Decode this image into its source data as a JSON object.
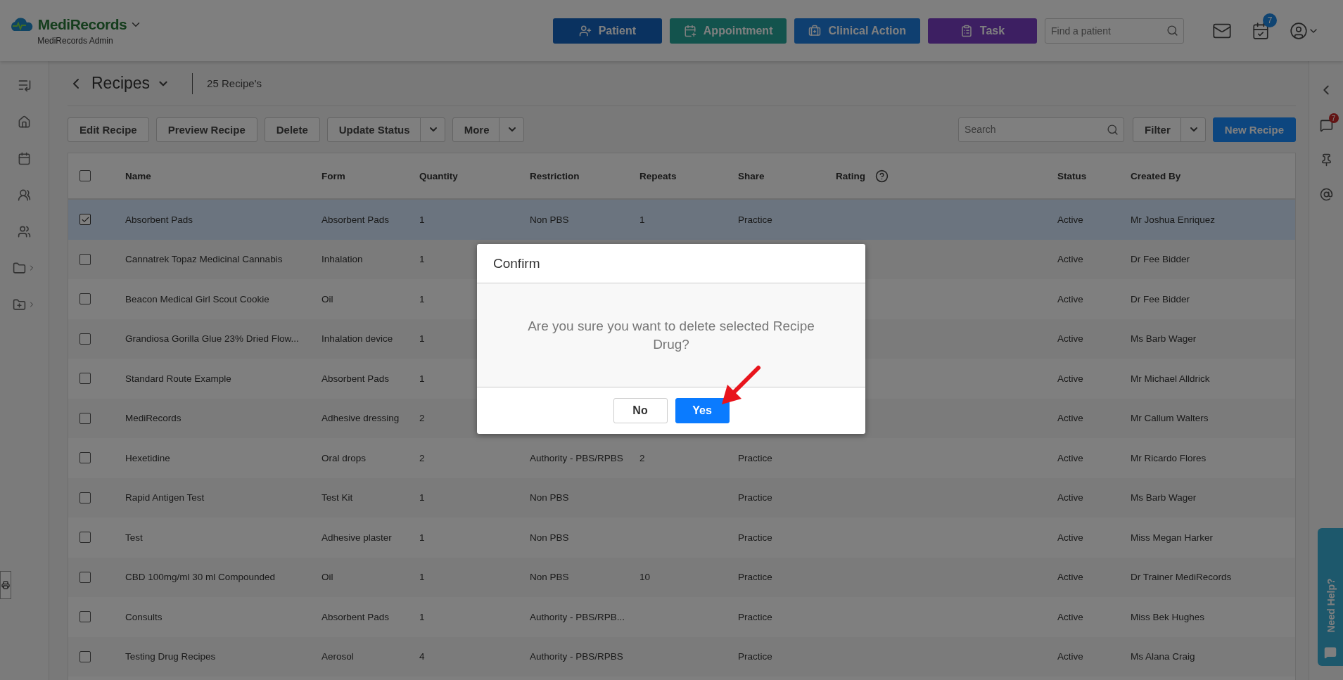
{
  "header": {
    "logo": "MediRecords",
    "subtitle": "MediRecords Admin",
    "actions": [
      {
        "label": "Patient"
      },
      {
        "label": "Appointment"
      },
      {
        "label": "Clinical Action"
      },
      {
        "label": "Task"
      }
    ],
    "search": {
      "placeholder": "Find a patient"
    },
    "calendar_badge": "7"
  },
  "page": {
    "title": "Recipes",
    "count": "25 Recipe's"
  },
  "toolbar": {
    "buttons": [
      {
        "label": "Edit Recipe",
        "kind": "plain"
      },
      {
        "label": "Preview Recipe",
        "kind": "plain"
      },
      {
        "label": "Delete",
        "kind": "plain"
      },
      {
        "label": "Update Status",
        "kind": "split"
      },
      {
        "label": "More",
        "kind": "split"
      }
    ],
    "search": {
      "placeholder": "Search"
    },
    "filter": {
      "label": "Filter",
      "kind": "split"
    },
    "primary": {
      "label": "New Recipe",
      "kind": "primary"
    }
  },
  "table": {
    "all_checked": false,
    "columns": [
      {
        "label": "Name",
        "help": false
      },
      {
        "label": "Form",
        "help": false
      },
      {
        "label": "Quantity",
        "help": false
      },
      {
        "label": "Restriction",
        "help": false
      },
      {
        "label": "Repeats",
        "help": false
      },
      {
        "label": "Share",
        "help": false
      },
      {
        "label": "Rating",
        "help": true
      },
      {
        "label": "Status",
        "help": false
      },
      {
        "label": "Created By",
        "help": false
      }
    ],
    "rows": [
      {
        "checked": true,
        "selected": true,
        "cells": [
          "Absorbent Pads",
          "Absorbent Pads",
          "1",
          "Non PBS",
          "1",
          "Practice",
          "",
          "Active",
          "Mr Joshua Enriquez"
        ]
      },
      {
        "checked": false,
        "selected": false,
        "cells": [
          "Cannatrek Topaz Medicinal Cannabis",
          "Inhalation",
          "1",
          "",
          "",
          "",
          "",
          "Active",
          "Dr Fee Bidder"
        ]
      },
      {
        "checked": false,
        "selected": false,
        "cells": [
          "Beacon Medical Girl Scout Cookie",
          "Oil",
          "1",
          "",
          "",
          "",
          "",
          "Active",
          "Dr Fee Bidder"
        ]
      },
      {
        "checked": false,
        "selected": false,
        "cells": [
          "Grandiosa Gorilla Glue 23% Dried Flow...",
          "Inhalation device",
          "1",
          "",
          "",
          "",
          "",
          "Active",
          "Ms Barb Wager"
        ]
      },
      {
        "checked": false,
        "selected": false,
        "cells": [
          "Standard Route Example",
          "Absorbent Pads",
          "1",
          "",
          "",
          "",
          "",
          "Active",
          "Mr Michael Alldrick"
        ]
      },
      {
        "checked": false,
        "selected": false,
        "cells": [
          "MediRecords",
          "Adhesive dressing",
          "2",
          "",
          "",
          "",
          "",
          "Active",
          "Mr Callum Walters"
        ]
      },
      {
        "checked": false,
        "selected": false,
        "cells": [
          "Hexetidine",
          "Oral drops",
          "2",
          "Authority - PBS/RPBS",
          "2",
          "Practice",
          "",
          "Active",
          "Mr Ricardo Flores"
        ]
      },
      {
        "checked": false,
        "selected": false,
        "cells": [
          "Rapid Antigen Test",
          "Test Kit",
          "1",
          "Non PBS",
          "",
          "Practice",
          "",
          "Active",
          "Ms Barb Wager"
        ]
      },
      {
        "checked": false,
        "selected": false,
        "cells": [
          "Test",
          "Adhesive plaster",
          "1",
          "Non PBS",
          "",
          "Practice",
          "",
          "Active",
          "Miss Megan Harker"
        ]
      },
      {
        "checked": false,
        "selected": false,
        "cells": [
          "CBD 100mg/ml 30 ml Compounded",
          "Oil",
          "1",
          "Non PBS",
          "10",
          "Practice",
          "",
          "Active",
          "Dr Trainer MediRecords"
        ]
      },
      {
        "checked": false,
        "selected": false,
        "cells": [
          "Consults",
          "Absorbent Pads",
          "1",
          "Authority - PBS/RPB...",
          "",
          "Practice",
          "",
          "Active",
          "Miss Bek Hughes"
        ]
      },
      {
        "checked": false,
        "selected": false,
        "cells": [
          "Testing Drug Recipes",
          "Aerosol",
          "4",
          "Authority - PBS/RPBS",
          "",
          "Practice",
          "",
          "Active",
          "Ms Alana Craig"
        ]
      }
    ]
  },
  "right_rail": {
    "chat_badge": "7",
    "help_tab": "Need Help?"
  },
  "dialog": {
    "title": "Confirm",
    "message": "Are you sure you want to delete selected Recipe Drug?",
    "buttons": [
      {
        "label": "No",
        "kind": "secondary"
      },
      {
        "label": "Yes",
        "kind": "primary"
      }
    ]
  }
}
